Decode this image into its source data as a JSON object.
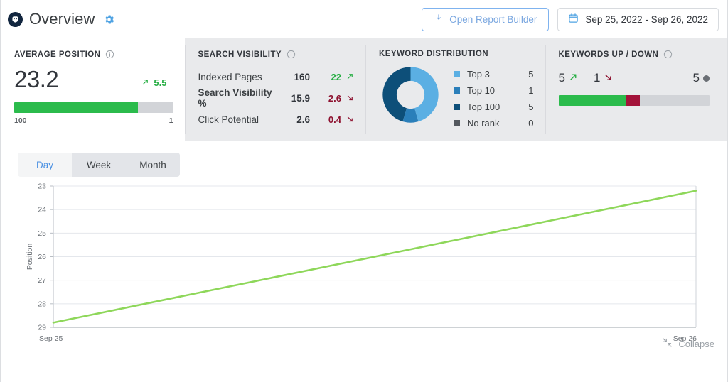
{
  "header": {
    "logo_name": "app-logo",
    "title": "Overview",
    "gear_label": "gear-icon",
    "report_button": "Open Report Builder",
    "date_range": "Sep 25, 2022 - Sep 26, 2022"
  },
  "average_position": {
    "title": "AVERAGE POSITION",
    "value": "23.2",
    "delta": "5.5",
    "delta_direction": "up",
    "bar_fill_percent": 78,
    "scale_left": "100",
    "scale_right": "1"
  },
  "search_visibility": {
    "title": "SEARCH VISIBILITY",
    "rows": [
      {
        "label": "Indexed Pages",
        "value": "160",
        "delta": "22",
        "direction": "up"
      },
      {
        "label": "Search Visibility %",
        "value": "15.9",
        "delta": "2.6",
        "direction": "down"
      },
      {
        "label": "Click Potential",
        "value": "2.6",
        "delta": "0.4",
        "direction": "down"
      }
    ]
  },
  "keyword_distribution": {
    "title": "KEYWORD DISTRIBUTION",
    "legend": [
      {
        "label": "Top 3",
        "value": "5",
        "color": "#5bafe3"
      },
      {
        "label": "Top 10",
        "value": "1",
        "color": "#2a7fba"
      },
      {
        "label": "Top 100",
        "value": "5",
        "color": "#0d4f79"
      },
      {
        "label": "No rank",
        "value": "0",
        "color": "#53585e"
      }
    ]
  },
  "keywords_up_down": {
    "title": "KEYWORDS UP / DOWN",
    "up_value": "5",
    "down_value": "1",
    "unchanged_value": "5",
    "bar_green_percent": 45,
    "bar_red_percent": 9
  },
  "tabs": [
    {
      "label": "Day",
      "active": true
    },
    {
      "label": "Week",
      "active": false
    },
    {
      "label": "Month",
      "active": false
    }
  ],
  "footer": {
    "collapse_label": "Collapse"
  },
  "chart_data": {
    "type": "line",
    "title": "",
    "xlabel": "",
    "ylabel": "Position",
    "x": [
      "Sep 25",
      "Sep 26"
    ],
    "series": [
      {
        "name": "Position",
        "values": [
          28.8,
          23.2
        ],
        "color": "#8ed75a"
      }
    ],
    "yticks": [
      23,
      24,
      25,
      26,
      27,
      28,
      29
    ],
    "ylim": [
      23,
      29
    ],
    "y_inverted": true,
    "grid": true,
    "legend": "none"
  }
}
